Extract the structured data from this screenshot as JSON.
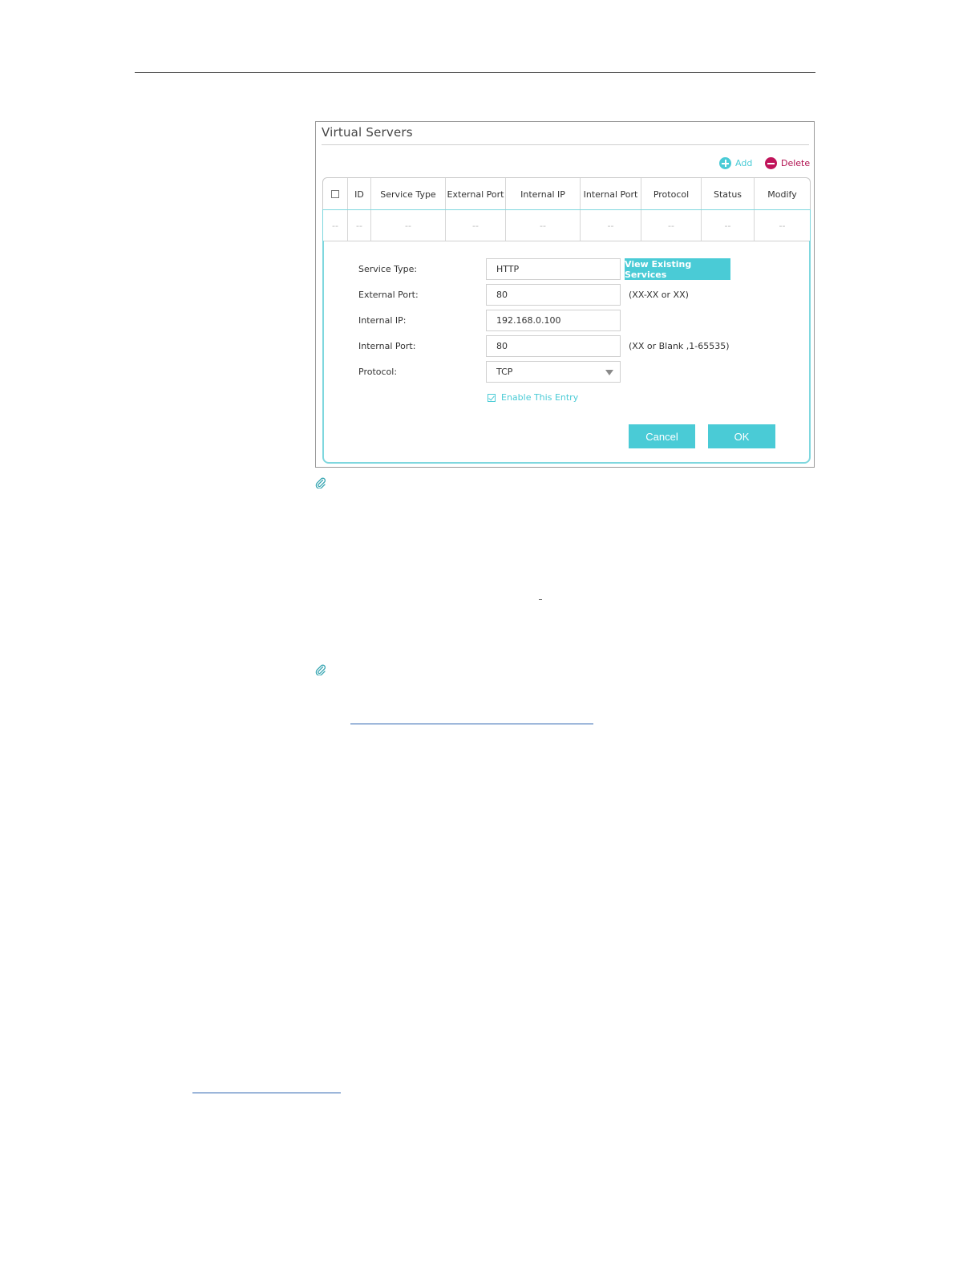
{
  "panel": {
    "title": "Virtual Servers",
    "add_label": "Add",
    "delete_label": "Delete"
  },
  "table": {
    "headers": [
      "",
      "ID",
      "Service Type",
      "External Port",
      "Internal IP",
      "Internal Port",
      "Protocol",
      "Status",
      "Modify"
    ],
    "row": [
      "--",
      "--",
      "--",
      "--",
      "--",
      "--",
      "--",
      "--",
      "--"
    ]
  },
  "form": {
    "service_type_label": "Service Type:",
    "service_type_value": "HTTP",
    "view_button_label": "View Existing Services",
    "external_port_label": "External Port:",
    "external_port_value": "80",
    "external_port_hint": "(XX-XX or XX)",
    "internal_ip_label": "Internal IP:",
    "internal_ip_value": "192.168.0.100",
    "internal_port_label": "Internal Port:",
    "internal_port_value": "80",
    "internal_port_hint": "(XX or Blank ,1-65535)",
    "protocol_label": "Protocol:",
    "protocol_value": "TCP",
    "enable_label": "Enable This Entry",
    "enable_checked": true,
    "cancel_label": "Cancel",
    "ok_label": "OK"
  },
  "colors": {
    "accent": "#4acbd6",
    "delete": "#c0145a"
  }
}
